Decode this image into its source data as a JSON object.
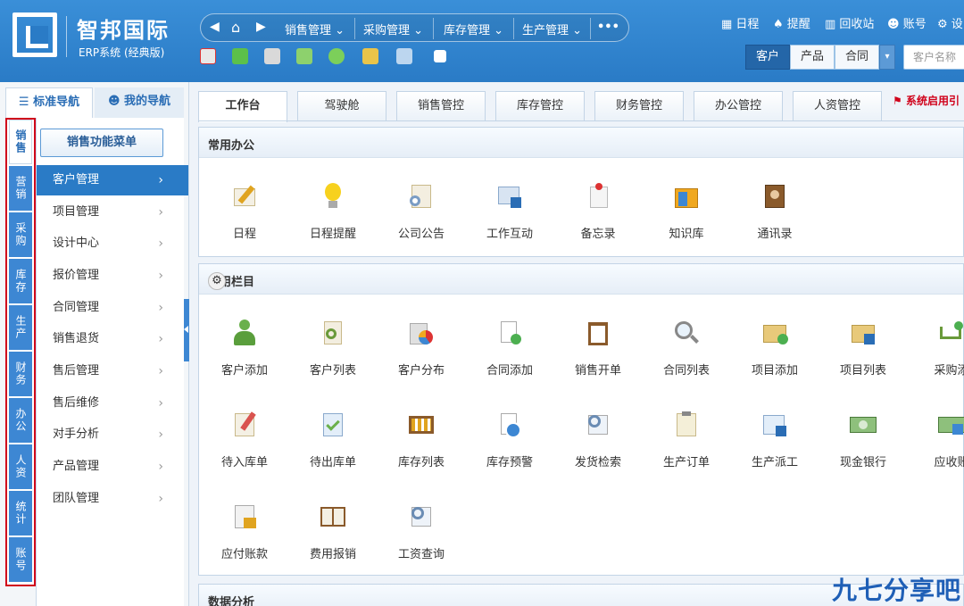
{
  "logo": {
    "title": "智邦国际",
    "subtitle": "ERP系统 (经典版)"
  },
  "topnav": {
    "items": [
      "销售管理",
      "采购管理",
      "库存管理",
      "生产管理"
    ],
    "more": "•••"
  },
  "utils": [
    "日程",
    "提醒",
    "回收站",
    "账号",
    "设"
  ],
  "search_segment": {
    "buttons": [
      "客户",
      "产品",
      "合同"
    ],
    "active": "客户",
    "dropdown": "▾",
    "placeholder": "客户名称"
  },
  "nav_tabs": {
    "standard": "标准导航",
    "mine": "我的导航"
  },
  "modules": [
    "销售",
    "营销",
    "采购",
    "库存",
    "生产",
    "财务",
    "办公",
    "人资",
    "统计",
    "账号"
  ],
  "active_module": "销售",
  "menu": {
    "button": "销售功能菜单",
    "items": [
      "客户管理",
      "项目管理",
      "设计中心",
      "报价管理",
      "合同管理",
      "销售退货",
      "售后管理",
      "售后维修",
      "对手分析",
      "产品管理",
      "团队管理"
    ],
    "active": "客户管理"
  },
  "tabs": [
    "工作台",
    "驾驶舱",
    "销售管控",
    "库存管控",
    "财务管控",
    "办公管控",
    "人资管控"
  ],
  "active_tab": "工作台",
  "notice": "系统启用引",
  "sections": {
    "office": {
      "title": "常用办公",
      "apps": [
        "日程",
        "日程提醒",
        "公司公告",
        "工作互动",
        "备忘录",
        "知识库",
        "通讯录"
      ]
    },
    "columns": {
      "title": "常用栏目",
      "row1": [
        "客户添加",
        "客户列表",
        "客户分布",
        "合同添加",
        "销售开单",
        "合同列表",
        "项目添加",
        "项目列表",
        "采购添"
      ],
      "row2": [
        "待入库单",
        "待出库单",
        "库存列表",
        "库存预警",
        "发货检索",
        "生产订单",
        "生产派工",
        "现金银行",
        "应收账"
      ],
      "row3": [
        "应付账款",
        "费用报销",
        "工资查询"
      ]
    },
    "analysis": {
      "title": "数据分析"
    }
  },
  "watermark": "九七分享吧"
}
